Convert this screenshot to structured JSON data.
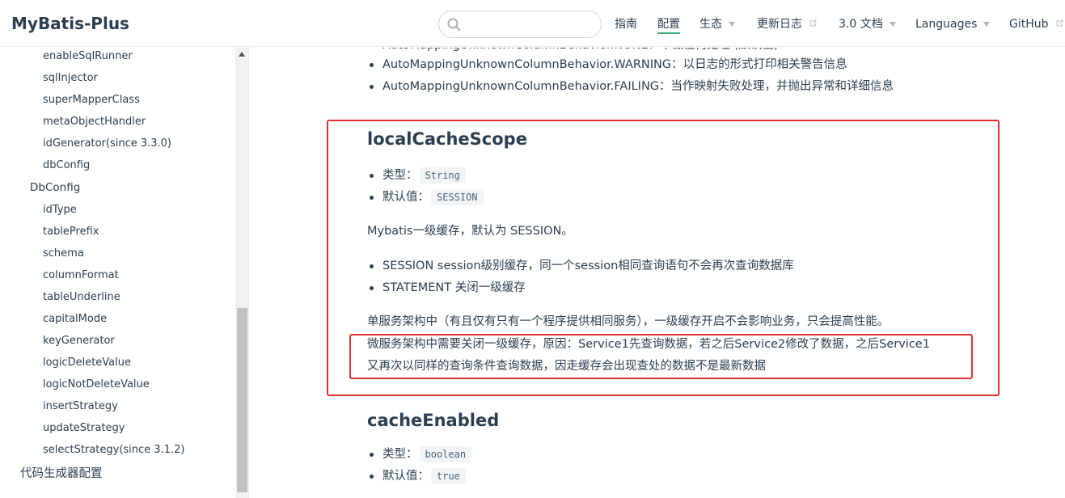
{
  "site_name": "MyBatis-Plus",
  "search": {
    "placeholder": ""
  },
  "nav": {
    "guide": "指南",
    "config": "配置",
    "ecosystem": "生态",
    "changelog": "更新日志",
    "docs30": "3.0 文档",
    "languages": "Languages",
    "github": "GitHub"
  },
  "sidebar": {
    "items": [
      "enableSqlRunner",
      "sqlInjector",
      "superMapperClass",
      "metaObjectHandler",
      "idGenerator(since 3.3.0)",
      "dbConfig",
      "DbConfig",
      "idType",
      "tablePrefix",
      "schema",
      "columnFormat",
      "tableUnderline",
      "capitalMode",
      "keyGenerator",
      "logicDeleteValue",
      "logicNotDeleteValue",
      "insertStrategy",
      "updateStrategy",
      "selectStrategy(since 3.1.2)",
      "代码生成器配置"
    ]
  },
  "content": {
    "top_cut": "AutoMappingUnknownColumnBehavior.NONE：不做任何处理 (默认值)",
    "top_warning": "AutoMappingUnknownColumnBehavior.WARNING：以日志的形式打印相关警告信息",
    "top_failing": "AutoMappingUnknownColumnBehavior.FAILING：当作映射失败处理，并抛出异常和详细信息",
    "s1": {
      "title": "localCacheScope",
      "type_label": "类型：",
      "type_value": "String",
      "default_label": "默认值：",
      "default_value": "SESSION",
      "desc": "Mybatis一级缓存，默认为 SESSION。",
      "session_bullet": "SESSION session级别缓存，同一个session相同查询语句不会再次查询数据库",
      "statement_bullet": "STATEMENT 关闭一级缓存",
      "para1": "单服务架构中（有且仅有只有一个程序提供相同服务），一级缓存开启不会影响业务，只会提高性能。",
      "para2_line1": "微服务架构中需要关闭一级缓存，原因：Service1先查询数据，若之后Service2修改了数据，之后Service1",
      "para2_line2": "又再次以同样的查询条件查询数据，因走缓存会出现查处的数据不是最新数据"
    },
    "s2": {
      "title": "cacheEnabled",
      "type_label": "类型：",
      "type_value": "boolean",
      "default_label": "默认值：",
      "default_value": "true"
    }
  },
  "colors": {
    "accent": "#3eaf7c",
    "highlight_box": "#e0302f",
    "text": "#2c3e50"
  }
}
